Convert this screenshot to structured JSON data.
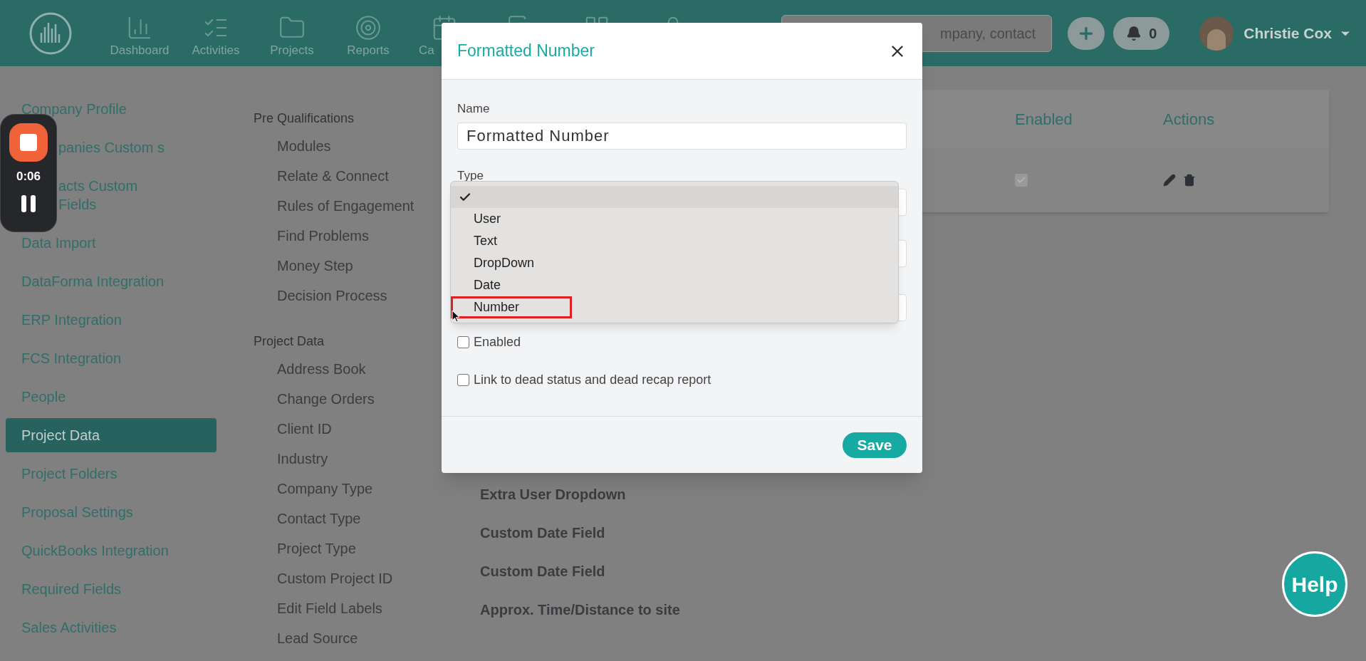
{
  "nav": {
    "items": [
      "Dashboard",
      "Activities",
      "Projects",
      "Reports",
      "Ca"
    ],
    "search": {
      "placeholder": "mpany, contact"
    },
    "notifications": "0",
    "user": "Christie Cox"
  },
  "sidebar": {
    "items": [
      {
        "label": "Company Profile",
        "selected": false
      },
      {
        "label": "panies Custom s",
        "selected": false,
        "kind": "covered"
      },
      {
        "label": "acts Custom Fields",
        "selected": false,
        "kind": "covered"
      },
      {
        "label": "Data Import",
        "selected": false
      },
      {
        "label": "DataForma Integration",
        "selected": false
      },
      {
        "label": "ERP Integration",
        "selected": false
      },
      {
        "label": "FCS Integration",
        "selected": false
      },
      {
        "label": "People",
        "selected": false
      },
      {
        "label": "Project Data",
        "selected": true
      },
      {
        "label": "Project Folders",
        "selected": false
      },
      {
        "label": "Proposal Settings",
        "selected": false
      },
      {
        "label": "QuickBooks Integration",
        "selected": false
      },
      {
        "label": "Required Fields",
        "selected": false
      },
      {
        "label": "Sales Activities",
        "selected": false
      }
    ]
  },
  "groups": [
    {
      "title": "Pre Qualifications",
      "items": [
        "Modules",
        "Relate & Connect",
        "Rules of Engagement",
        "Find Problems",
        "Money Step",
        "Decision Process"
      ]
    },
    {
      "title": "Project Data",
      "items": [
        "Address Book",
        "Change Orders",
        "Client ID",
        "Industry",
        "Company Type",
        "Contact Type",
        "Project Type",
        "Custom Project ID",
        "Edit Field Labels",
        "Lead Source"
      ]
    }
  ],
  "table": {
    "columns": [
      "Enabled",
      "Actions"
    ],
    "rows": [
      {
        "enabled": true
      }
    ]
  },
  "fields": [
    "Extra User Dropdown",
    "Custom Date Field",
    "Custom Date Field",
    "Approx. Time/Distance to site"
  ],
  "recorder": {
    "time": "0:06"
  },
  "help": "Help",
  "modal": {
    "title": "Formatted Number",
    "name_label": "Name",
    "name_value": "Formatted Number",
    "type_label": "Type",
    "type_options": [
      {
        "selected": true,
        "marked": false
      },
      {
        "label": "User",
        "selected": false,
        "marked": false
      },
      {
        "label": "Text",
        "selected": false,
        "marked": false
      },
      {
        "label": "DropDown",
        "selected": false,
        "marked": false
      },
      {
        "label": "Date",
        "selected": false,
        "marked": false
      },
      {
        "label": "Number",
        "selected": false,
        "marked": true
      }
    ],
    "checkboxes": [
      {
        "label": "Enabled",
        "checked": false
      },
      {
        "label": "Link to dead status and dead recap report",
        "checked": false
      }
    ],
    "save": "Save"
  }
}
